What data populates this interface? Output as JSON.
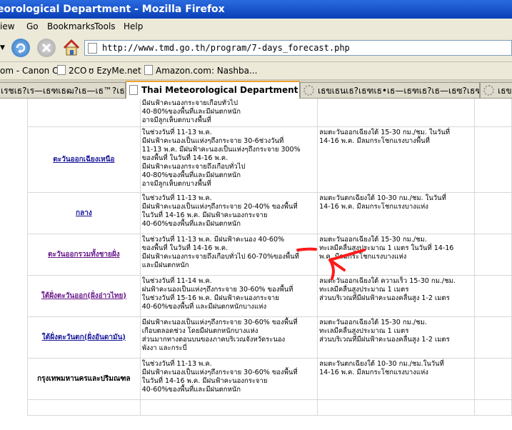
{
  "window": {
    "title": "eorological Department - Mozilla Firefox"
  },
  "menu": [
    "iew",
    "Go",
    "Bookmarks",
    "Tools",
    "Help"
  ],
  "address": {
    "url": "http://www.tmd.go.th/program/7-days_forecast.php"
  },
  "bookmarks": [
    "om - Canon C...",
    "2CO",
    "EzyMe.net",
    "Amazon.com: Nashba..."
  ],
  "tabs": [
    {
      "label": "เรชเธ?เร—เธฑเธฒ?เธ—เธ™?เธฃเธ™?เธ—...",
      "active": false
    },
    {
      "label": "Thai Meteorological Department",
      "active": true
    },
    {
      "label": "เธขเธนเธ?เธฑเธ•เธ—เธฑเธ?เธ—เธซ?เธฑเน€เธ™...",
      "active": false
    },
    {
      "label": "เธขเธ?เธฑ",
      "active": false
    }
  ],
  "forecast": {
    "rows": [
      {
        "region": "",
        "weather": [
          "มีฝนฟ้าคะนองกระจายเกือบทั่วไป",
          "40-80%ของพื้นที่และมีฝนตกหนัก",
          "อาจมีลูกเห็บตกบางพื้นที่"
        ],
        "wind": []
      },
      {
        "region": "ตะวันออกเฉียงเหนือ",
        "weather": [
          "ในช่วงวันที่ 11-13 พ.ค.",
          "มีฝนฟ้าคะนองเป็นแห่งๆถึงกระจาย 30-6ช่วงวันที่",
          "11-13 พ.ค. มีฝนฟ้าคะนองเป็นแห่งๆถึงกระจาย 300%",
          "ของพื้นที่ ในวันที่ 14-16 พ.ค.",
          "มีฝนฟ้าคะนองกระจายถึงเกือบทั่วไป",
          "40-80%ของพื้นที่และมีฝนตกหนัก",
          "อาจมีลูกเห็บตกบางพื้นที่"
        ],
        "wind": [
          "ลมตะวันออกเฉียงใต้ 15-30 กม./ชม. ในวันที่",
          "14-16 พ.ค. มีลมกระโชกแรงบางพื้นที่"
        ]
      },
      {
        "region": "กลาง",
        "weather": [
          "ในช่วงวันที่ 11-13 พ.ค.",
          "มีฝนฟ้าคะนองเป็นแห่งๆถึงกระจาย 20-40% ของพื้นที่",
          "ในวันที่ 14-16 พ.ค. มีฝนฟ้าคะนองกระจาย",
          "40-60%ของพื้นที่และมีฝนตกหนัก"
        ],
        "wind": [
          "ลมตะวันตกเฉียงใต้ 10-30 กม./ชม. ในวันที่",
          "14-16 พ.ค. มีลมกระโชกแรงบางแห่ง"
        ]
      },
      {
        "region": "ตะวันออกรวมทั้งชายฝั่ง",
        "weather": [
          "ในช่วงวันที่ 11-13 พ.ค. มีฝนฟ้าคะนอง 40-60%",
          "ของพื้นที่ ในวันที่ 14-16 พ.ค.",
          "มีฝนฟ้าคะนองกระจายถึงเกือบทั่วไป 60-70%ของพื้นที่",
          "และมีฝนตกหนัก"
        ],
        "wind": [
          "ลมตะวันออกเฉียงใต้ 15-30 กม./ชม.",
          "ทะเลมีคลื่นสูงประมาณ 1 เมตร ในวันที่ 14-16",
          "พ.ค. มีลมกระโชกแรงบางแห่ง"
        ]
      },
      {
        "region": "ใต้ฝั่งตะวันออก(ฝั่งอ่าวไทย)",
        "weather": [
          "ในช่วงวันที่ 11-14 พ.ค.",
          "ฝนฟ้าคะนองเป็นแห่งๆถึงกระจาย 30-60% ของพื้นที่",
          "ในช่วงวันที่ 15-16 พ.ค. มีฝนฟ้าคะนองกระจาย",
          "40-60%ของพื้นที่ และมีฝนตกหนักบางแห่ง"
        ],
        "wind": [
          "ลมตะวันออกเฉียงใต้ ความเร็ว 15-30 กม./ชม.",
          "ทะเลมีคลื่นสูงประมาณ 1 เมตร",
          "ส่วนบริเวณที่มีฝนฟ้าคะนองคลื่นสูง 1-2 เมตร"
        ]
      },
      {
        "region": "ใต้ฝั่งตะวันตก(ฝั่งอันดามัน)",
        "weather": [
          "มีฝนฟ้าคะนองเป็นแห่งๆถึงกระจาย 30-60% ของพื้นที่",
          "เกือบตลอดช่วง โดยมีฝนตกหนักบางแห่ง",
          "ส่วนมากทางตอนบนของภาคบริเวณจังหวัดระนอง",
          "พังงา และกระบี่"
        ],
        "wind": [
          "ลมตะวันออกเฉียงใต้ 15-30 กม./ชม.",
          "ทะเลมีคลื่นสูงประมาณ 1 เมตร",
          "ส่วนบริเวณที่มีฝนฟ้าคะนองคลื่นสูง 1-2 เมตร"
        ]
      },
      {
        "region": "กรุงเทพมหานครและปริมณฑล",
        "weather": [
          "ในช่วงวันที่ 11-13 พ.ค.",
          "มีฝนฟ้าคะนองเป็นแห่งๆถึงกระจาย 30-60% ของพื้นที่",
          "ในวันที่ 14-16 พ.ค. มีฝนฟ้าคะนองกระจาย",
          "40-60%ของพื้นที่และมีฝนตกหนัก"
        ],
        "wind": [
          "ลมตะวันตกเฉียงใต้ 10-30 กม./ชม.ในวันที่",
          "14-16 พ.ค. มีลมกระโชกแรงบางแห่ง"
        ]
      }
    ]
  },
  "colors": {
    "annotation": "#ff1a1a",
    "link": "#1a1a9c",
    "visited": "#6a1a8c"
  }
}
